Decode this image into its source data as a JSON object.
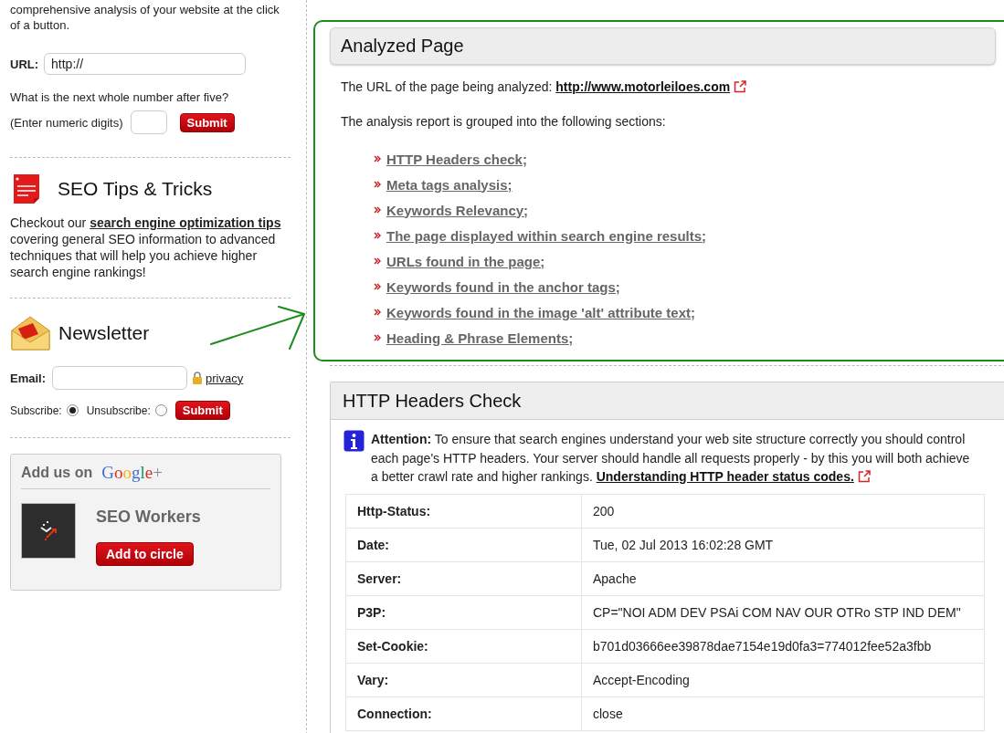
{
  "sidebar": {
    "intro": "comprehensive analysis of your website at the click of a button.",
    "url_field": {
      "label": "URL:",
      "value": "http://"
    },
    "captcha": {
      "question": "What is the next whole number after five?",
      "hint": "(Enter numeric digits)",
      "button": "Submit"
    },
    "tips": {
      "title": "SEO Tips & Tricks",
      "text_before": "Checkout our",
      "link": "search engine optimization tips",
      "text_after": "covering general SEO information to advanced techniques that will help you achieve higher search engine rankings!"
    },
    "newsletter": {
      "title": "Newsletter",
      "email_label": "Email:",
      "privacy": "privacy",
      "options": [
        {
          "label": "Subscribe:",
          "selected": true
        },
        {
          "label": "Unsubscribe:",
          "selected": false
        }
      ],
      "button": "Submit"
    },
    "google": {
      "lead": "Add us on",
      "logo": "Google+",
      "page_name": "SEO Workers",
      "button": "Add to circle"
    }
  },
  "analyzed_page": {
    "title": "Analyzed Page",
    "url_label": "The URL of the page being analyzed:",
    "url": "http://www.motorleiloes.com",
    "intro": "The analysis report is grouped into the following sections:",
    "sections": [
      "HTTP Headers check;",
      "Meta tags analysis;",
      "Keywords Relevancy;",
      "The page displayed within search engine results;",
      "URLs found in the page;",
      "Keywords found in the anchor tags;",
      "Keywords found in the image 'alt' attribute text;",
      "Heading & Phrase Elements;"
    ]
  },
  "headers_check": {
    "title": "HTTP Headers Check",
    "attention": "**Attention:** To ensure that search engines understand your web site structure correctly you should control each page's HTTP headers. Your server should handle all requests properly - by this you will both achieve a better crawl rate and higher rankings.",
    "link": "Understanding HTTP header status codes.",
    "rows": [
      {
        "name": "Http-Status:",
        "value": "200"
      },
      {
        "name": "Date:",
        "value": "Tue, 02 Jul 2013 16:02:28 GMT"
      },
      {
        "name": "Server:",
        "value": "Apache"
      },
      {
        "name": "P3P:",
        "value": "CP=\"NOI ADM DEV PSAi COM NAV OUR OTRo STP IND DEM\""
      },
      {
        "name": "Set-Cookie:",
        "value": "b701d03666ee39878dae7154e19d0fa3=774012fee52a3fbb"
      },
      {
        "name": "Vary:",
        "value": "Accept-Encoding"
      },
      {
        "name": "Connection:",
        "value": "close"
      }
    ]
  }
}
